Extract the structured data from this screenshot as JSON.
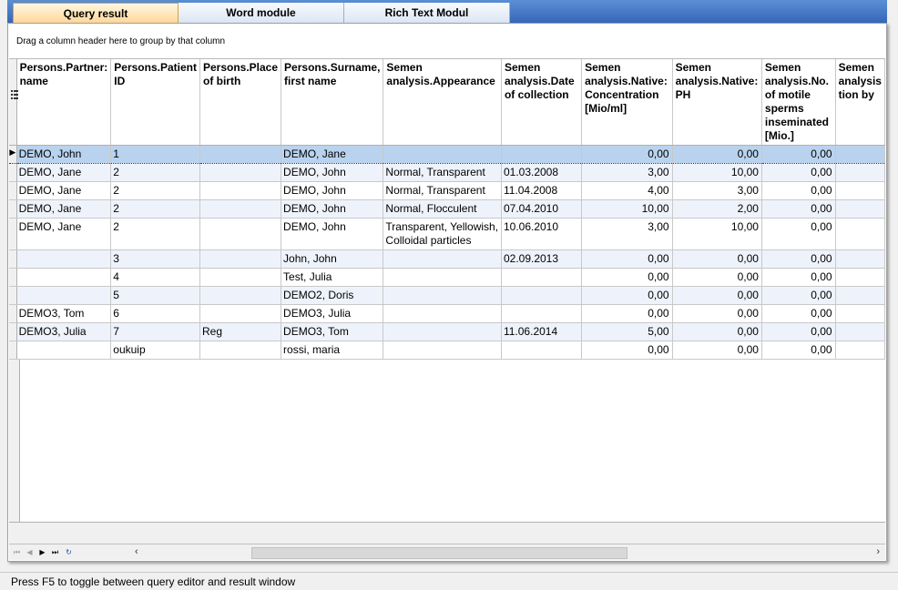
{
  "tabs": [
    {
      "label": "Query result",
      "active": true
    },
    {
      "label": "Word module",
      "active": false
    },
    {
      "label": "Rich Text Modul",
      "active": false
    }
  ],
  "grid": {
    "group_hint": "Drag a column header here to group by that column",
    "columns": [
      "Persons.Partner: name",
      "Persons.Patient ID",
      "Persons.Place of birth",
      "Persons.Surname, first name",
      "Semen analysis.Appearance",
      "Semen analysis.Date of collection",
      "Semen analysis.Native: Concentration [Mio/ml]",
      "Semen analysis.Native: PH",
      "Semen analysis.No. of motile sperms inseminated [Mio.]",
      "Semen analysis tion by"
    ],
    "rows": [
      [
        "DEMO, John",
        "1",
        "",
        "DEMO, Jane",
        "",
        "",
        "0,00",
        "0,00",
        "0,00",
        ""
      ],
      [
        "DEMO, Jane",
        "2",
        "",
        "DEMO, John",
        "Normal, Transparent",
        "01.03.2008",
        "3,00",
        "10,00",
        "0,00",
        ""
      ],
      [
        "DEMO, Jane",
        "2",
        "",
        "DEMO, John",
        "Normal, Transparent",
        "11.04.2008",
        "4,00",
        "3,00",
        "0,00",
        ""
      ],
      [
        "DEMO, Jane",
        "2",
        "",
        "DEMO, John",
        "Normal, Flocculent",
        "07.04.2010",
        "10,00",
        "2,00",
        "0,00",
        ""
      ],
      [
        "DEMO, Jane",
        "2",
        "",
        "DEMO, John",
        "Transparent, Yellowish, Colloidal particles",
        "10.06.2010",
        "3,00",
        "10,00",
        "0,00",
        ""
      ],
      [
        "",
        "3",
        "",
        "John, John",
        "",
        "02.09.2013",
        "0,00",
        "0,00",
        "0,00",
        ""
      ],
      [
        "",
        "4",
        "",
        "Test, Julia",
        "",
        "",
        "0,00",
        "0,00",
        "0,00",
        ""
      ],
      [
        "",
        "5",
        "",
        "DEMO2, Doris",
        "",
        "",
        "0,00",
        "0,00",
        "0,00",
        ""
      ],
      [
        "DEMO3, Tom",
        "6",
        "",
        "DEMO3, Julia",
        "",
        "",
        "0,00",
        "0,00",
        "0,00",
        ""
      ],
      [
        "DEMO3, Julia",
        "7",
        "Reg",
        "DEMO3, Tom",
        "",
        "11.06.2014",
        "5,00",
        "0,00",
        "0,00",
        ""
      ],
      [
        "",
        "oukuip",
        "",
        "rossi, maria",
        "",
        "",
        "0,00",
        "0,00",
        "0,00",
        ""
      ]
    ],
    "selected_row": 0
  },
  "navigator": {
    "icons": [
      "first-icon",
      "prev-icon",
      "next-icon",
      "last-icon",
      "refresh-icon"
    ],
    "scroll_left": "‹",
    "scroll_right": "›"
  },
  "status": {
    "text": "Press F5 to toggle between query editor and result window"
  }
}
